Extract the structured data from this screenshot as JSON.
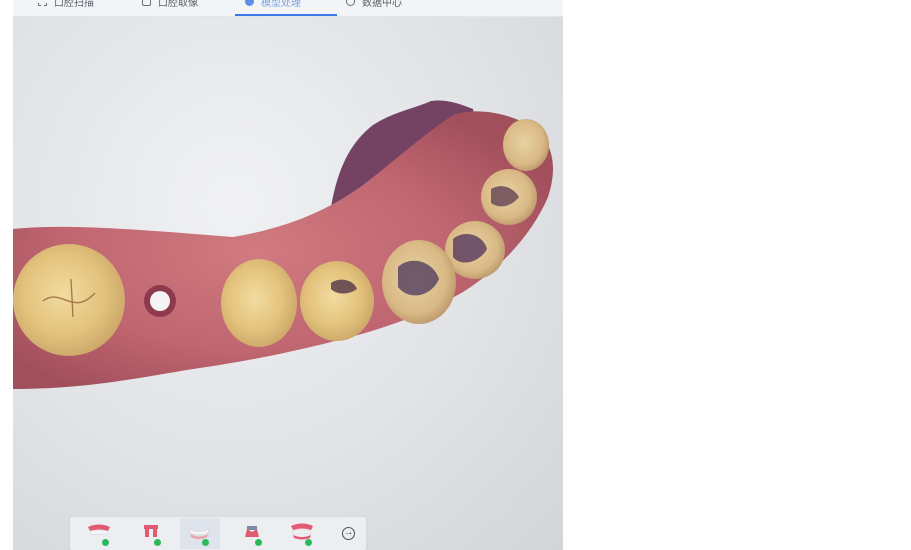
{
  "top_tabs": [
    {
      "label": "口腔扫描",
      "icon": "scan-frame-icon",
      "active": false
    },
    {
      "label": "口腔取像",
      "icon": "import-icon",
      "active": false
    },
    {
      "label": "模型处理",
      "icon": "model-process-icon",
      "active": true
    },
    {
      "label": "数据中心",
      "icon": "data-center-icon",
      "active": false
    }
  ],
  "colors": {
    "accent": "#3b78e7",
    "active_tab_text": "#7aa3e6",
    "check": "#2eb85c",
    "gum": "#c46a72"
  },
  "bottom_toolbar": {
    "items": [
      {
        "icon": "upper-jaw-icon",
        "completed": true,
        "active": false
      },
      {
        "icon": "prep-tooth-icon",
        "completed": true,
        "active": false
      },
      {
        "icon": "lower-jaw-icon",
        "completed": true,
        "active": true
      },
      {
        "icon": "bite-icon",
        "completed": true,
        "active": false
      },
      {
        "icon": "full-arch-icon",
        "completed": true,
        "active": false
      }
    ],
    "next_icon": "arrow-right-circle-icon",
    "next_glyph": "→"
  }
}
